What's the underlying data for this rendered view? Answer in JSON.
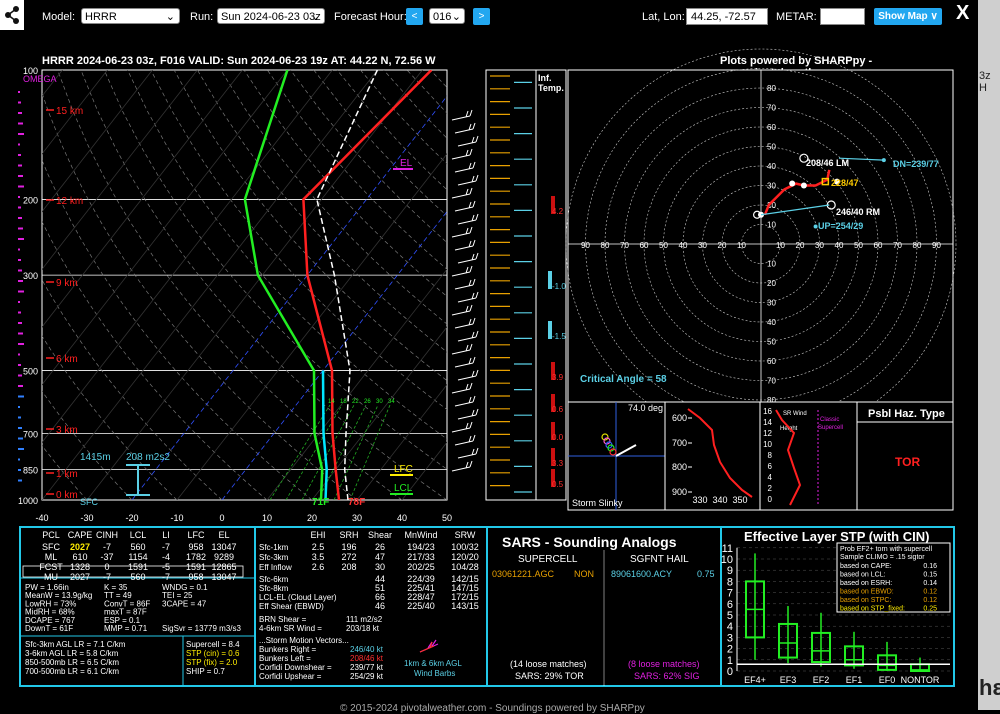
{
  "topbar": {
    "model_label": "Model:",
    "model_value": "HRRR",
    "run_label": "Run:",
    "run_value": "Sun 2024-06-23 03z",
    "forecast_label": "Forecast Hour:",
    "prev_arrow": "<",
    "hour_value": "016",
    "next_arrow": ">",
    "latlon_label": "Lat, Lon:",
    "latlon_value": "44.25, -72.57",
    "metar_label": "METAR:",
    "metar_value": "",
    "show_map": "Show Map ∨",
    "close": "X"
  },
  "right_strip": {
    "text1": "3z H",
    "text2": "hε"
  },
  "header": {
    "title": "HRRR 2024-06-23 03z, F016  VALID: Sun 2024-06-23 19z  AT: 44.22 N, 72.56 W",
    "credit": "Plots powered by SHARPpy - www.pivotalweather.com"
  },
  "skewt": {
    "omega": "OMEGA",
    "pressures": [
      "100",
      "200",
      "300",
      "500",
      "700",
      "850",
      "1000"
    ],
    "heights": [
      "15 km",
      "12 km",
      "9 km",
      "6 km",
      "3 km",
      "1 km",
      "0 km"
    ],
    "temps": [
      "-40",
      "-30",
      "-20",
      "-10",
      "0",
      "10",
      "20",
      "30",
      "40",
      "50"
    ],
    "el": "EL",
    "lfc": "LFC",
    "lcl": "LCL",
    "sfc_t": "71F",
    "sfc_td": "78F",
    "sfc": "SFC",
    "hel_bottom": "1415m",
    "hel_val": "208 m2s2",
    "inf_temp": "Inf.\nTemp.",
    "inf_marks": [
      "4.2",
      "-1.0",
      "-1.5",
      "3.9",
      "0.6",
      "0.0",
      "3.3",
      "0.5"
    ],
    "mix_lines": [
      "14",
      "18",
      "22",
      "26",
      "30",
      "34"
    ]
  },
  "hodograph": {
    "rings_x": [
      "90",
      "80",
      "70",
      "60",
      "50",
      "40",
      "30",
      "20",
      "10",
      "10",
      "20",
      "30",
      "40",
      "50",
      "60",
      "70",
      "80",
      "90"
    ],
    "rings_y": [
      "80",
      "70",
      "60",
      "50",
      "40",
      "30",
      "20",
      "10",
      "10",
      "20",
      "30",
      "40",
      "50",
      "60",
      "70",
      "80"
    ],
    "lm": "208/46 LM",
    "mean": "228/47",
    "rm": "246/40 RM",
    "dn": "DN=239/77",
    "up": "UP=254/29",
    "crit": "Critical Angle = 58"
  },
  "slinky": {
    "deg": "74.0 deg",
    "label": "Storm Slinky"
  },
  "theta": {
    "y": [
      "600",
      "700",
      "800",
      "900"
    ],
    "x": [
      "330",
      "340",
      "350"
    ]
  },
  "srw": {
    "label1": "SR Wind",
    "label2": "Height",
    "classic": "Classic Supercell",
    "y": [
      "16",
      "14",
      "12",
      "10",
      "8",
      "6",
      "4",
      "2",
      "0"
    ]
  },
  "hazard": {
    "title": "Psbl Haz. Type",
    "value": "TOR"
  },
  "table1": {
    "headers": [
      "PCL",
      "CAPE",
      "CINH",
      "LCL",
      "LI",
      "LFC",
      "EL"
    ],
    "rows": [
      [
        "SFC",
        "2027",
        "-7",
        "560",
        "-7",
        "958",
        "13047"
      ],
      [
        "ML",
        "610",
        "-37",
        "1154",
        "-4",
        "1782",
        "9289"
      ],
      [
        "FCST",
        "1328",
        "0",
        "1591",
        "-5",
        "1591",
        "12865"
      ],
      [
        "MU",
        "2027",
        "-7",
        "560",
        "-7",
        "958",
        "13047"
      ]
    ],
    "misc": [
      [
        "PW = 1.66in",
        "K = 35",
        "WNDG = 0.1"
      ],
      [
        "MeanW = 13.9g/kg",
        "TT = 49",
        "TEI = 25"
      ],
      [
        "LowRH = 73%",
        "ConvT = 86F",
        "3CAPE = 47"
      ],
      [
        "MidRH = 68%",
        "maxT = 87F",
        ""
      ],
      [
        "DCAPE = 767",
        "ESP = 0.1",
        ""
      ],
      [
        "DownT = 61F",
        "MMP = 0.71",
        "SigSvr = 13779 m3/s3"
      ]
    ],
    "lapse": [
      "Sfc-3km AGL LR = 7.1 C/km",
      "3-6km AGL LR = 5.8 C/km",
      "850-500mb LR = 6.5 C/km",
      "700-500mb LR = 6.1 C/km"
    ],
    "params": [
      "Supercell = 8.4",
      "STP (cin) = 0.6",
      "STP (fix) = 2.0",
      "SHIP = 0.7"
    ]
  },
  "table2": {
    "headers": [
      "EHI",
      "SRH",
      "Shear",
      "MnWind",
      "SRW"
    ],
    "rows1": [
      [
        "Sfc-1km",
        "2.5",
        "196",
        "26",
        "194/23",
        "100/32"
      ],
      [
        "Sfc-3km",
        "3.5",
        "272",
        "47",
        "217/33",
        "120/20"
      ],
      [
        "Eff Inflow",
        "2.6",
        "208",
        "30",
        "202/25",
        "104/28"
      ]
    ],
    "rows2": [
      [
        "Sfc-6km",
        "",
        "",
        "44",
        "224/39",
        "142/15"
      ],
      [
        "Sfc-8km",
        "",
        "",
        "51",
        "225/41",
        "147/15"
      ],
      [
        "LCL-EL (Cloud Layer)",
        "",
        "",
        "66",
        "228/47",
        "172/15"
      ],
      [
        "Eff Shear (EBWD)",
        "",
        "",
        "46",
        "225/40",
        "143/15"
      ]
    ],
    "brn": [
      "BRN Shear =",
      "111 m2/s2"
    ],
    "srwind": [
      "4-6km SR Wind =",
      "203/18 kt"
    ],
    "storm_title": "...Storm Motion Vectors...",
    "storm": [
      [
        "Bunkers Right =",
        "246/40 kt"
      ],
      [
        "Bunkers Left =",
        "208/46 kt"
      ],
      [
        "Corfidi Downshear =",
        "239/77 kt"
      ],
      [
        "Corfidi Upshear =",
        "254/29 kt"
      ]
    ],
    "barbs_label": "1km & 6km AGL\nWind Barbs"
  },
  "sars": {
    "title": "SARS - Sounding Analogs",
    "supercell": "SUPERCELL",
    "hail": "SGFNT HAIL",
    "sc_match": "03061221.AGC",
    "sc_type": "NON",
    "hail_match": "89061600.ACY",
    "hail_val": "0.75",
    "sc_loose": "(14 loose matches)",
    "hail_loose": "(8 loose matches)",
    "sc_pct": "SARS: 29% TOR",
    "hail_pct": "SARS: 62% SIG"
  },
  "stp": {
    "title": "Effective Layer STP (with CIN)",
    "y": [
      "11",
      "10",
      "9",
      "8",
      "7",
      "6",
      "5",
      "4",
      "3",
      "2",
      "1",
      "0"
    ],
    "cats": [
      "EF4+",
      "EF3",
      "EF2",
      "EF1",
      "EF0",
      "NONTOR"
    ],
    "legend_title1": "Prob EF2+ torn with supercell",
    "legend_title2": "Sample CLIMO = .15 sigtor",
    "legend": [
      [
        "based on CAPE:",
        "0.16"
      ],
      [
        "based on LCL:",
        "0.15"
      ],
      [
        "based on ESRH:",
        "0.14"
      ],
      [
        "based on EBWD:",
        "0.12"
      ],
      [
        "based on STPC:",
        "0.12"
      ],
      [
        "based on STP_fixed:",
        "0.25"
      ]
    ]
  },
  "footer": "© 2015-2024 pivotalweather.com - Soundings powered by SHARPpy",
  "chart_data": {
    "type": "line",
    "title": "HRRR 2024-06-23 03z, F016  VALID: Sun 2024-06-23 19z  AT: 44.22 N, 72.56 W",
    "xlabel": "",
    "ylabel": "",
    "xlim": [
      -40,
      50
    ],
    "ylim": [
      1000,
      100
    ],
    "y_scale": "log-pressure",
    "series": [
      {
        "name": "",
        "color": "#ff2020",
        "pressure": [
          1000,
          850,
          700,
          500,
          300,
          200,
          100
        ],
        "x": [
          26,
          20,
          13,
          2,
          -20,
          -34,
          -28
        ]
      },
      {
        "name": "",
        "color": "#22ee22",
        "pressure": [
          1000,
          850,
          700,
          500,
          300,
          200,
          100
        ],
        "x": [
          22,
          17,
          9,
          -2,
          -31,
          -47,
          -60
        ]
      },
      {
        "name": "",
        "color": "#ffffff",
        "pressure": [
          1000,
          850,
          700,
          500,
          300,
          200,
          100
        ],
        "x": [
          28,
          22,
          16,
          6,
          -14,
          -31,
          -40
        ]
      },
      {
        "name": "",
        "color": "#00e5ff",
        "pressure": [
          1000,
          850,
          700,
          500
        ],
        "x": [
          23,
          18,
          11,
          0
        ]
      }
    ],
    "hodograph": {
      "type": "scatter",
      "rm": "246/40 RM",
      "lm": "208/46 LM",
      "mean": "228/47",
      "dn": "DN=239/77",
      "up": "UP=254/29",
      "u": [
        2,
        4,
        12,
        18,
        22,
        28,
        34,
        35
      ],
      "v": [
        15,
        20,
        28,
        31,
        30,
        30,
        33,
        38
      ]
    }
  }
}
